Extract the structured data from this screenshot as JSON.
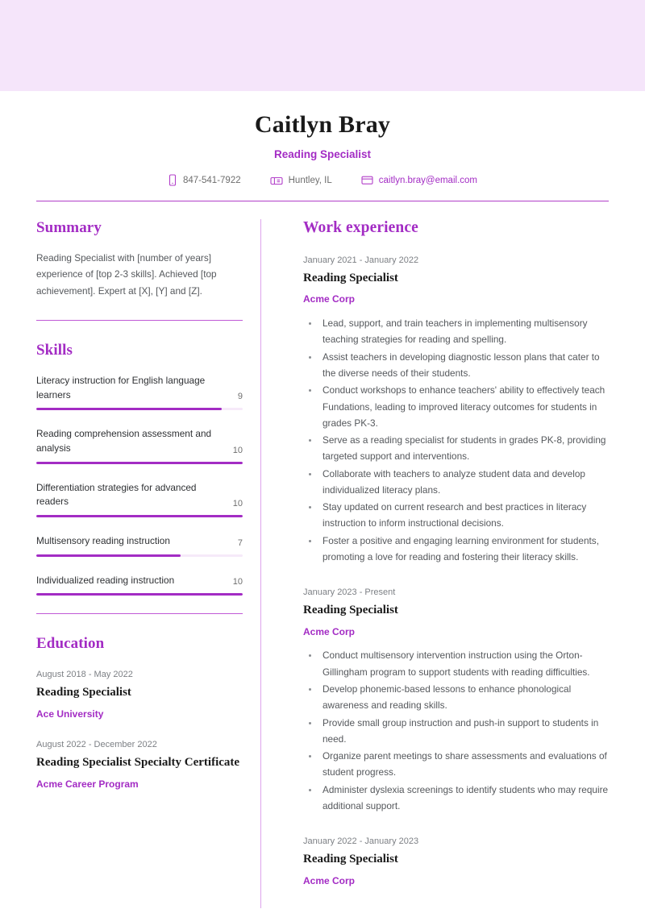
{
  "theme": {
    "banner_color": "#f5e5fa",
    "accent_color": "#a32cc4",
    "divider_color": "#dda4ec",
    "body_text_color": "#55585c",
    "muted_text_color": "#7d8085"
  },
  "header": {
    "name": "Caitlyn Bray",
    "role": "Reading Specialist",
    "contacts": [
      {
        "icon": "phone-icon",
        "text": "847-541-7922",
        "is_link": false
      },
      {
        "icon": "location-mailbox-icon",
        "text": "Huntley, IL",
        "is_link": false
      },
      {
        "icon": "envelope-icon",
        "text": "caitlyn.bray@email.com",
        "is_link": true
      }
    ]
  },
  "summary": {
    "title": "Summary",
    "text": "Reading Specialist with [number of years] experience of [top 2-3 skills]. Achieved [top achievement]. Expert at [X], [Y] and [Z]."
  },
  "skills": {
    "title": "Skills",
    "max_score": 10,
    "items": [
      {
        "name": "Literacy instruction for English language learners",
        "score": 9
      },
      {
        "name": "Reading comprehension assessment and analysis",
        "score": 10
      },
      {
        "name": "Differentiation strategies for advanced readers",
        "score": 10
      },
      {
        "name": "Multisensory reading instruction",
        "score": 7
      },
      {
        "name": "Individualized reading instruction",
        "score": 10
      }
    ]
  },
  "education": {
    "title": "Education",
    "items": [
      {
        "date": "August 2018 - May 2022",
        "title": "Reading Specialist",
        "org": "Ace University"
      },
      {
        "date": "August 2022 - December 2022",
        "title": "Reading Specialist Specialty Certificate",
        "org": "Acme Career Program"
      }
    ]
  },
  "work_experience": {
    "title": "Work experience",
    "jobs": [
      {
        "date": "January 2021 - January 2022",
        "title": "Reading Specialist",
        "org": "Acme Corp",
        "bullets": [
          "Lead, support, and train teachers in implementing multisensory teaching strategies for reading and spelling.",
          "Assist teachers in developing diagnostic lesson plans that cater to the diverse needs of their students.",
          "Conduct workshops to enhance teachers' ability to effectively teach Fundations, leading to improved literacy outcomes for students in grades PK-3.",
          "Serve as a reading specialist for students in grades PK-8, providing targeted support and interventions.",
          "Collaborate with teachers to analyze student data and develop individualized literacy plans.",
          "Stay updated on current research and best practices in literacy instruction to inform instructional decisions.",
          "Foster a positive and engaging learning environment for students, promoting a love for reading and fostering their literacy skills."
        ]
      },
      {
        "date": "January 2023 - Present",
        "title": "Reading Specialist",
        "org": "Acme Corp",
        "bullets": [
          "Conduct multisensory intervention instruction using the Orton-Gillingham program to support students with reading difficulties.",
          "Develop phonemic-based lessons to enhance phonological awareness and reading skills.",
          "Provide small group instruction and push-in support to students in need.",
          "Organize parent meetings to share assessments and evaluations of student progress.",
          "Administer dyslexia screenings to identify students who may require additional support."
        ]
      },
      {
        "date": "January 2022 - January 2023",
        "title": "Reading Specialist",
        "org": "Acme Corp",
        "bullets": []
      }
    ]
  }
}
